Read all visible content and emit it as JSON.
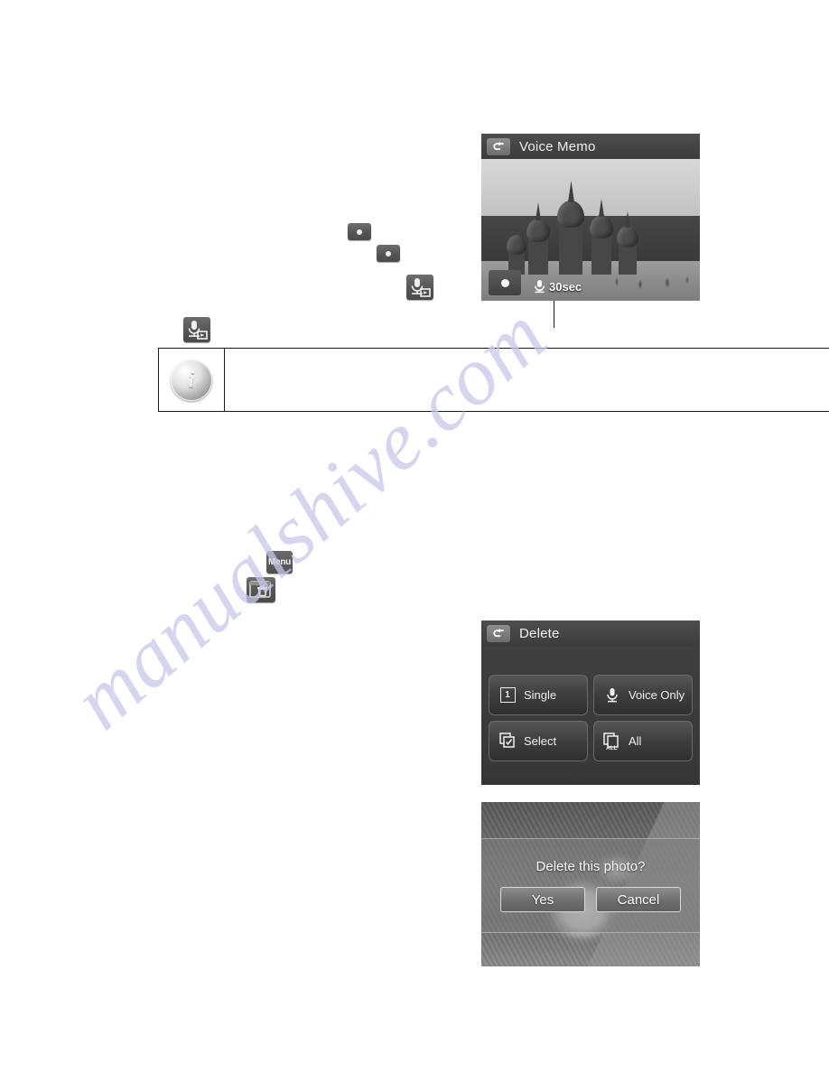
{
  "page": {
    "watermark": "manualshive.com"
  },
  "inline_icons": {
    "record_1": "record-button-icon",
    "record_2": "record-button-icon",
    "voice_memo_1": "voice-memo-icon",
    "voice_memo_2": "voice-memo-icon",
    "menu_label": "Menu",
    "trash": "delete-trash-icon"
  },
  "note_box": {
    "icon": "information-icon",
    "text": ""
  },
  "voice_memo_screen": {
    "back_icon": "back-arrow-icon",
    "title": "Voice Memo",
    "record_icon": "record-indicator-icon",
    "mic_icon": "microphone-icon",
    "duration": "30sec"
  },
  "delete_screen": {
    "back_icon": "back-arrow-icon",
    "title": "Delete",
    "options": [
      {
        "label": "Single",
        "icon": "single-image-icon"
      },
      {
        "label": "Voice Only",
        "icon": "microphone-icon"
      },
      {
        "label": "Select",
        "icon": "select-images-icon"
      },
      {
        "label": "All",
        "icon": "all-images-icon"
      }
    ]
  },
  "confirm_screen": {
    "message": "Delete this photo?",
    "buttons": [
      {
        "label": "Yes"
      },
      {
        "label": "Cancel"
      }
    ]
  }
}
